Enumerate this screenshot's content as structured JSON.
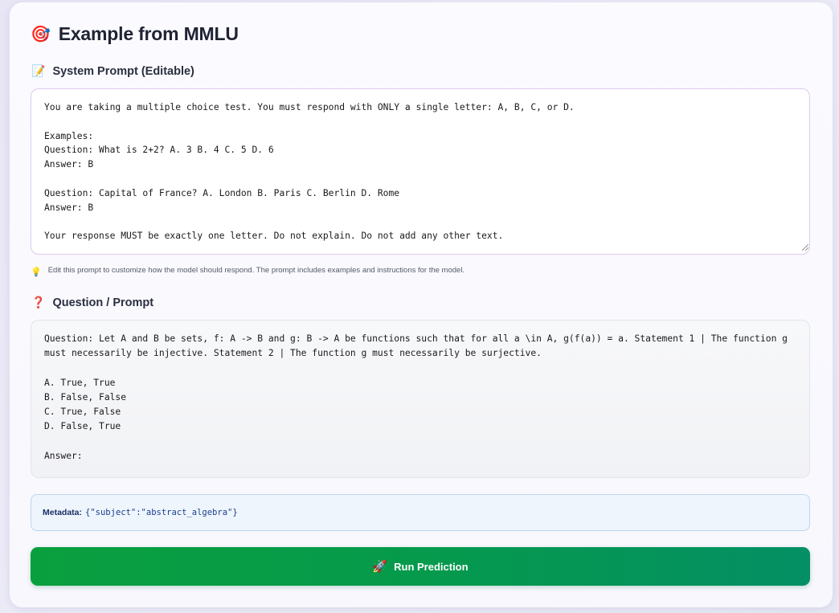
{
  "header": {
    "icon": "target-icon",
    "icon_glyph": "🎯",
    "title": "Example from MMLU"
  },
  "system_prompt": {
    "icon": "memo-icon",
    "icon_glyph": "📝",
    "label": "System Prompt (Editable)",
    "value": "You are taking a multiple choice test. You must respond with ONLY a single letter: A, B, C, or D.\n\nExamples:\nQuestion: What is 2+2? A. 3 B. 4 C. 5 D. 6\nAnswer: B\n\nQuestion: Capital of France? A. London B. Paris C. Berlin D. Rome\nAnswer: B\n\nYour response MUST be exactly one letter. Do not explain. Do not add any other text.",
    "hint_icon": "lightbulb-icon",
    "hint_glyph": "💡",
    "hint": "Edit this prompt to customize how the model should respond. The prompt includes examples and instructions for the model."
  },
  "question": {
    "icon": "question-mark-icon",
    "icon_glyph": "❓",
    "label": "Question / Prompt",
    "text": "Question: Let A and B be sets, f: A -> B and g: B -> A be functions such that for all a \\in A, g(f(a)) = a. Statement 1 | The function g must necessarily be injective. Statement 2 | The function g must necessarily be surjective.\n\nA. True, True\nB. False, False\nC. True, False\nD. False, True\n\nAnswer:"
  },
  "metadata": {
    "label": "Metadata:",
    "value": "{\"subject\":\"abstract_algebra\"}"
  },
  "run_button": {
    "icon": "rocket-icon",
    "icon_glyph": "🚀",
    "label": "Run Prediction"
  },
  "colors": {
    "accent_green": "#059a4c",
    "metadata_bg": "#eef5fd",
    "textarea_border": "#ddc9ee"
  }
}
